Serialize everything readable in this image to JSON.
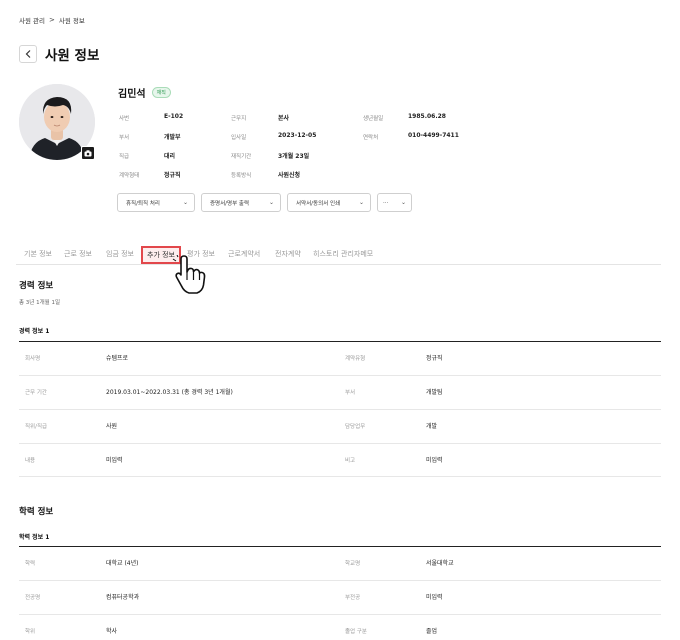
{
  "breadcrumb": {
    "parent": "사원 관리",
    "separator": ">",
    "current": "사원 정보"
  },
  "header": {
    "back_icon": "chevron-left-icon",
    "title": "사원 정보"
  },
  "profile": {
    "name": "김민석",
    "status": "재직",
    "info": {
      "emp_no_label": "사번",
      "emp_no": "E-102",
      "workplace_label": "근무지",
      "workplace": "본사",
      "birth_label": "생년월일",
      "birth": "1985.06.28",
      "dept_label": "부서",
      "dept": "개발부",
      "hire_label": "입사일",
      "hire": "2023-12-05",
      "contact_label": "연락처",
      "contact": "010-4499-7411",
      "rank_label": "직급",
      "rank": "대리",
      "tenure_label": "재직기간",
      "tenure": "3개월 23일",
      "contract_label": "계약형태",
      "contract": "정규직",
      "reg_label": "등록방식",
      "reg": "사원신청"
    }
  },
  "actions": {
    "leave": "휴직/퇴직 처리",
    "certificate": "증명서/명부 출력",
    "print": "서약서/동의서 인쇄",
    "more": "···"
  },
  "tabs": [
    "기본 정보",
    "근로 정보",
    "임금 정보",
    "추가 정보",
    "평가 정보",
    "근로계약서",
    "전자계약",
    "히스토리",
    "관리자메모"
  ],
  "active_tab": "추가 정보",
  "career": {
    "title": "경력 정보",
    "total": "총 3년 1개월 1일",
    "item_title": "경력 정보 1",
    "rows": [
      {
        "l1": "회사명",
        "v1": "슈템프로",
        "l2": "계약유형",
        "v2": "정규직"
      },
      {
        "l1": "근무 기간",
        "v1": "2019.03.01~2022.03.31 (총 경력 3년 1개월)",
        "l2": "부서",
        "v2": "개발팀"
      },
      {
        "l1": "직위/직급",
        "v1": "사원",
        "l2": "담당업무",
        "v2": "개발"
      },
      {
        "l1": "내용",
        "v1": "미입력",
        "l2": "비고",
        "v2": "미입력"
      }
    ]
  },
  "education": {
    "title": "학력 정보",
    "item_title": "학력 정보 1",
    "rows": [
      {
        "l1": "학력",
        "v1": "대학교 (4년)",
        "l2": "학교명",
        "v2": "서울대학교"
      },
      {
        "l1": "전공명",
        "v1": "컴퓨터공학과",
        "l2": "부전공",
        "v2": "미입력"
      },
      {
        "l1": "학위",
        "v1": "학사",
        "l2": "졸업 구분",
        "v2": "졸업"
      }
    ]
  },
  "colors": {
    "active_tab_border": "#e2474b",
    "badge_green": "#2e9a52"
  }
}
